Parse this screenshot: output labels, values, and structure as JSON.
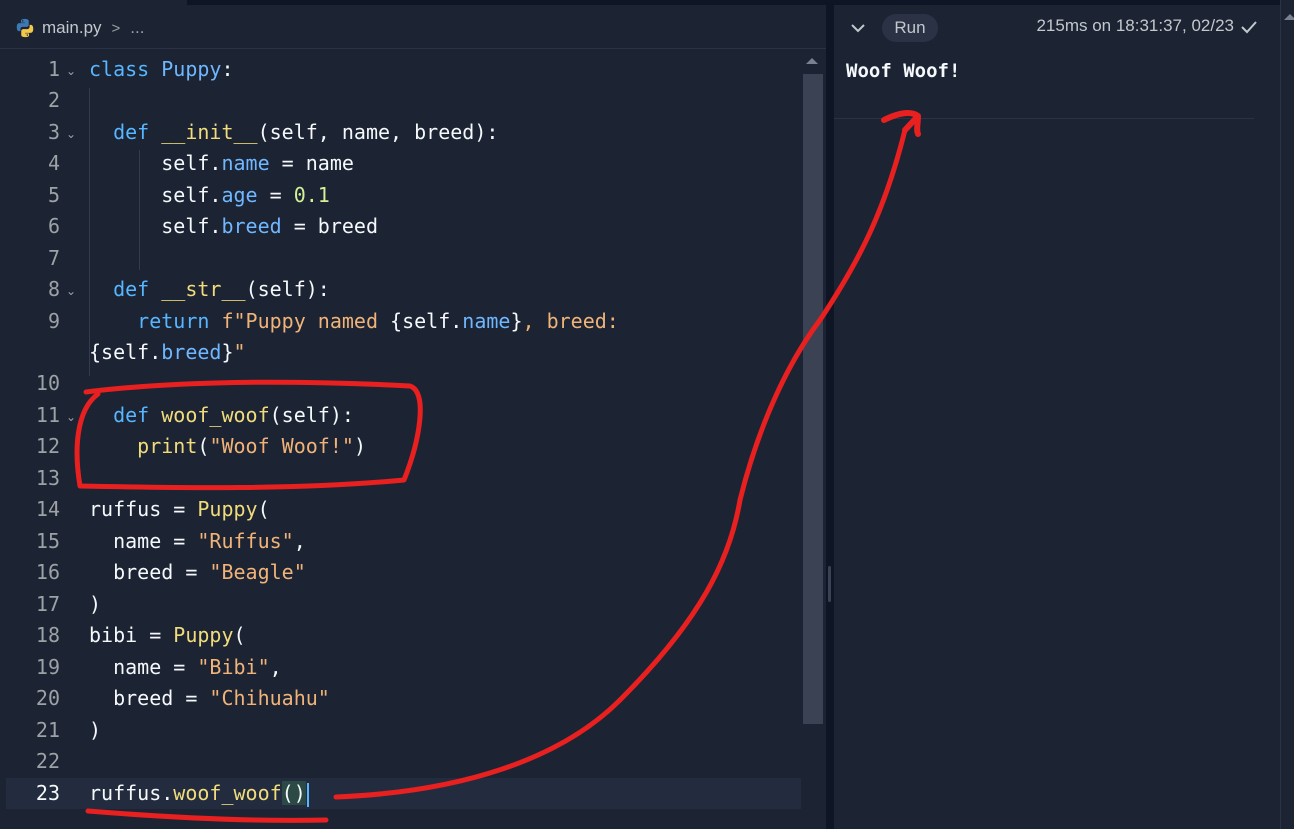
{
  "breadcrumb": {
    "filename": "main.py",
    "separator": ">",
    "more": "..."
  },
  "editor": {
    "line_numbers": [
      "1",
      "2",
      "3",
      "4",
      "5",
      "6",
      "7",
      "8",
      "9",
      "",
      "10",
      "11",
      "12",
      "13",
      "14",
      "15",
      "16",
      "17",
      "18",
      "19",
      "20",
      "21",
      "22",
      "23"
    ],
    "active_line": "23"
  },
  "console": {
    "run_label": "Run",
    "status": "215ms on 18:31:37, 02/23",
    "output": "Woof Woof!"
  },
  "icons": {
    "file": "python-icon",
    "collapse": "chevron-down-icon",
    "success": "check-icon"
  },
  "colors": {
    "background": "#1c2333",
    "annotation": "#e8201f",
    "keyword": "#56b6ff",
    "function": "#f1dc7c",
    "string": "#f0b378",
    "number": "#d3f196"
  }
}
